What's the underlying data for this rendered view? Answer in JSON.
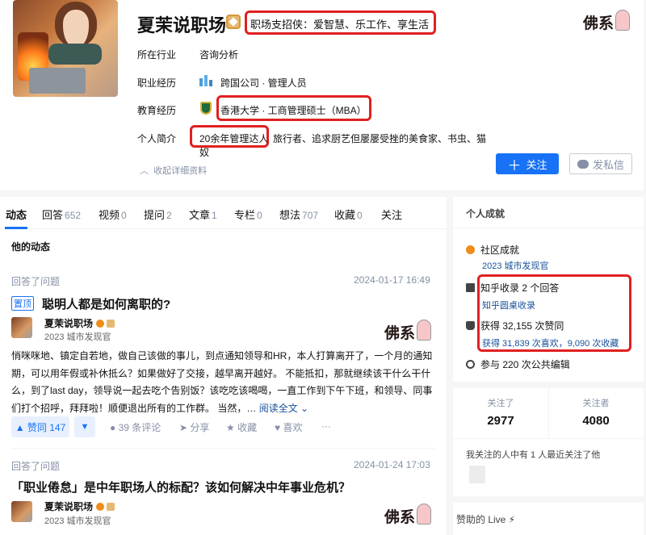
{
  "profile": {
    "name": "夏茉说职场",
    "headline": "职场支招侠：爱智慧、乐工作、享生活",
    "fields": [
      {
        "label": "所在行业",
        "value": "咨询分析"
      },
      {
        "label": "职业经历",
        "value": "跨国公司 · 管理人员"
      },
      {
        "label": "教育经历",
        "value": "香港大学 · 工商管理硕士（MBA）"
      },
      {
        "label": "个人简介",
        "value_highlight": "20余年管理达人",
        "value_rest": "旅行者、追求厨艺但屡屡受挫的美食家、书虫、猫",
        "value_wrap": "奴"
      }
    ],
    "collapse_label": "收起详细资料",
    "follow_button": "关注",
    "message_button": "发私信",
    "logo_text": "佛系"
  },
  "tabs": [
    {
      "label": "动态",
      "count": ""
    },
    {
      "label": "回答",
      "count": "652"
    },
    {
      "label": "视频",
      "count": "0"
    },
    {
      "label": "提问",
      "count": "2"
    },
    {
      "label": "文章",
      "count": "1"
    },
    {
      "label": "专栏",
      "count": "0"
    },
    {
      "label": "想法",
      "count": "707"
    },
    {
      "label": "收藏",
      "count": "0"
    },
    {
      "label": "关注",
      "count": ""
    }
  ],
  "feed": {
    "section_title": "他的动态",
    "items": [
      {
        "type": "回答了问题",
        "time": "2024-01-17 16:49",
        "pin": "置顶",
        "title": "聪明人都是如何离职的?",
        "author": "夏茉说职场",
        "author_sub": "2023 城市发现官",
        "excerpt": "悄咪咪地、镇定自若地，做自己该做的事儿，到点通知领导和HR，本人打算离开了，一个月的通知期，可以用年假或补休抵么？如果做好了交接，越早离开越好。 不能抵扣，那就继续该干什么干什么，到了last day，领导说一起去吃个告别饭？该吃吃该喝喝，一直工作到下午下班，和领导、同事们打个招呼，拜拜啦！顺便退出所有的工作群。 当然，…",
        "read_more": "阅读全文",
        "vote": "▲ 赞同 147",
        "comments": "39 条评论",
        "share": "分享",
        "collect": "收藏",
        "like": "喜欢",
        "more": "···"
      },
      {
        "type": "回答了问题",
        "time": "2024-01-24 17:03",
        "title": "「职业倦怠」是中年职场人的标配？该如何解决中年事业危机？",
        "author": "夏茉说职场",
        "author_sub": "2023 城市发现官"
      }
    ]
  },
  "achievements": {
    "title": "个人成就",
    "community": "社区成就",
    "community_sub": "2023 城市发现官",
    "included": "知乎收录 2 个回答",
    "included_sub": "知乎圆桌收录",
    "upvotes": "获得 32,155 次赞同",
    "upvotes_sub": "获得 31,839 次喜欢，9,090 次收藏",
    "edits": "参与 220 次公共编辑"
  },
  "stats": {
    "following_label": "关注了",
    "following": "2977",
    "followers_label": "关注者",
    "followers": "4080",
    "mutual_text": "我关注的人中有 1 人最近关注了他"
  },
  "live": {
    "title": "赞助的 Live ⚡"
  },
  "colors": {
    "primary": "#1772f6",
    "highlight_box": "#e02020",
    "muted": "#8590a6",
    "link": "#175199"
  }
}
